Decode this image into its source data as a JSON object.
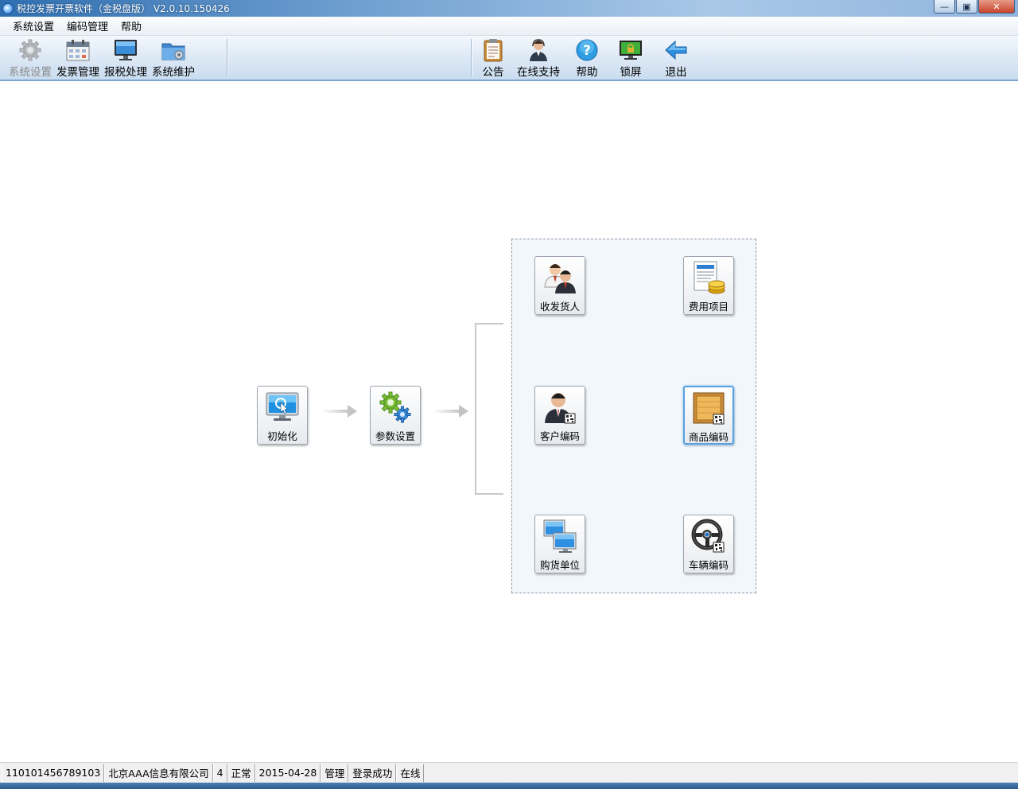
{
  "window": {
    "title": "税控发票开票软件（金税盘版） V2.0.10.150426",
    "minimize_glyph": "—",
    "maximize_glyph": "▣",
    "close_glyph": "✕"
  },
  "menu": {
    "items": [
      {
        "label": "系统设置"
      },
      {
        "label": "编码管理"
      },
      {
        "label": "帮助"
      }
    ]
  },
  "toolbar": {
    "left": [
      {
        "label": "系统设置",
        "icon": "gear-icon",
        "disabled": true
      },
      {
        "label": "发票管理",
        "icon": "invoice-calendar-icon",
        "disabled": false
      },
      {
        "label": "报税处理",
        "icon": "monitor-icon",
        "disabled": false
      },
      {
        "label": "系统维护",
        "icon": "folder-gear-icon",
        "disabled": false
      }
    ],
    "right": [
      {
        "label": "公告",
        "icon": "clipboard-icon"
      },
      {
        "label": "在线支持",
        "icon": "support-person-icon"
      },
      {
        "label": "帮助",
        "icon": "help-icon"
      },
      {
        "label": "锁屏",
        "icon": "lock-screen-icon"
      },
      {
        "label": "退出",
        "icon": "exit-arrow-icon"
      }
    ]
  },
  "flow": {
    "init": {
      "label": "初始化",
      "icon": "monitor-cursor-icon"
    },
    "params": {
      "label": "参数设置",
      "icon": "gears-icon"
    },
    "items": [
      {
        "label": "收发货人",
        "icon": "people-icon",
        "selected": false
      },
      {
        "label": "费用项目",
        "icon": "document-coins-icon",
        "selected": false
      },
      {
        "label": "客户编码",
        "icon": "customer-code-icon",
        "selected": false
      },
      {
        "label": "商品编码",
        "icon": "product-box-icon",
        "selected": true
      },
      {
        "label": "购货单位",
        "icon": "computers-icon",
        "selected": false
      },
      {
        "label": "车辆编码",
        "icon": "steering-wheel-icon",
        "selected": false
      }
    ]
  },
  "status": {
    "tax_id": "110101456789103",
    "company": "北京AAA信息有限公司",
    "number": "4",
    "state": "正常",
    "date": "2015-04-28",
    "role": "管理",
    "login": "登录成功",
    "online": "在线"
  },
  "colors": {
    "titlebar": "#2f6fb0",
    "toolbar_border": "#7fa6d1",
    "group_bg": "#f2f7fb",
    "selected_border": "#5aa0e0"
  }
}
